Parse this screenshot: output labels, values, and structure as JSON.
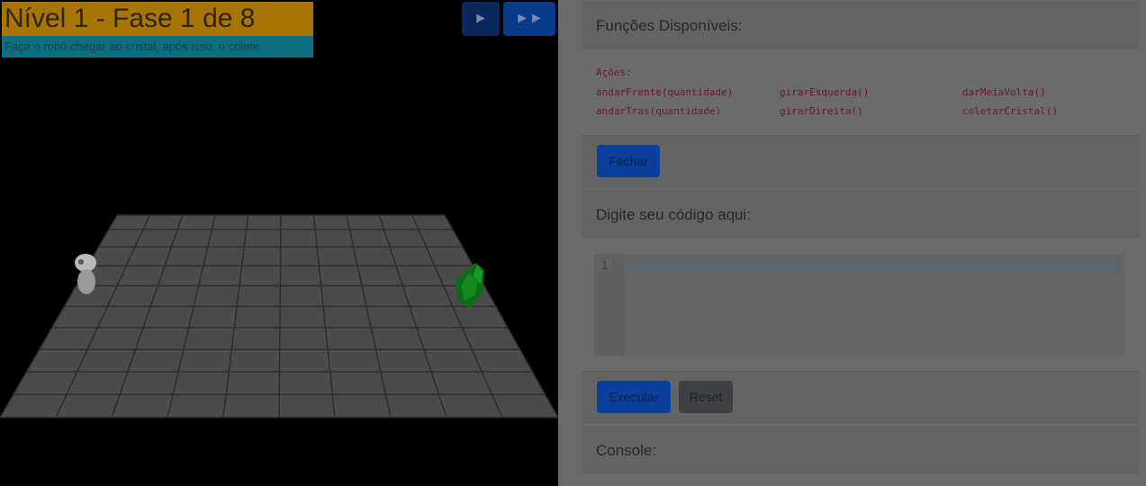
{
  "game": {
    "level_title": "Nível 1 - Fase 1 de 8",
    "subtitle": "Faça o robô chegar ao cristal, após isso, o colete",
    "play_label": "►",
    "fast_label": "►►"
  },
  "functions": {
    "header": "Funções Disponíveis:",
    "actions_label": "Ações:",
    "col1": [
      "andarFrente(quantidade)",
      "andarTras(quantidade)"
    ],
    "col2": [
      "girarEsquerda()",
      "girarDireita()"
    ],
    "col3": [
      "darMeiaVolta()",
      "coletarCristal()"
    ],
    "close_button": "Fechar"
  },
  "editor": {
    "header": "Digite seu código aqui:",
    "line_number": "1",
    "run_button": "Executar",
    "reset_button": "Reset"
  },
  "console": {
    "header": "Console:"
  }
}
